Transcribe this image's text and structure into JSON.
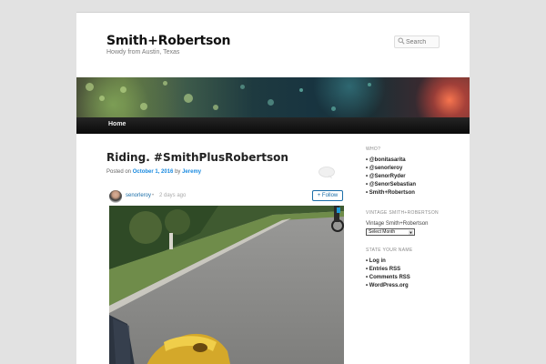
{
  "header": {
    "site_title": "Smith+Robertson",
    "site_description": "Howdy from Austin, Texas"
  },
  "search": {
    "placeholder": "Search",
    "icon": "search-icon"
  },
  "nav": {
    "items": [
      {
        "label": "Home"
      }
    ]
  },
  "post": {
    "title": "Riding. #SmithPlusRobertson",
    "posted_prefix": "Posted on",
    "date": "October 1, 2016",
    "by": "by",
    "author": "Jeremy",
    "comment_icon": "comment-bubble-icon"
  },
  "instagram": {
    "username": "senorleroy",
    "separator": "•",
    "time": "2 days ago",
    "follow_label": "+ Follow"
  },
  "sidebar": {
    "who_heading": "WHO?",
    "who_links": [
      "@bonitasarita",
      "@senorleroy",
      "@SenorRyder",
      "@SenorSebastian",
      "Smith+Robertson"
    ],
    "vintage_heading": "VINTAGE SMITH+ROBERTSON",
    "vintage_text": "Vintage Smith+Robertson",
    "vintage_select": "Select Month",
    "state_heading": "STATE YOUR NAME",
    "state_links": [
      "Log in",
      "Entries RSS",
      "Comments RSS",
      "WordPress.org"
    ]
  },
  "colors": {
    "link": "#1b8be0",
    "nav_bg": "#111111",
    "page_bg": "#e2e2e2"
  }
}
